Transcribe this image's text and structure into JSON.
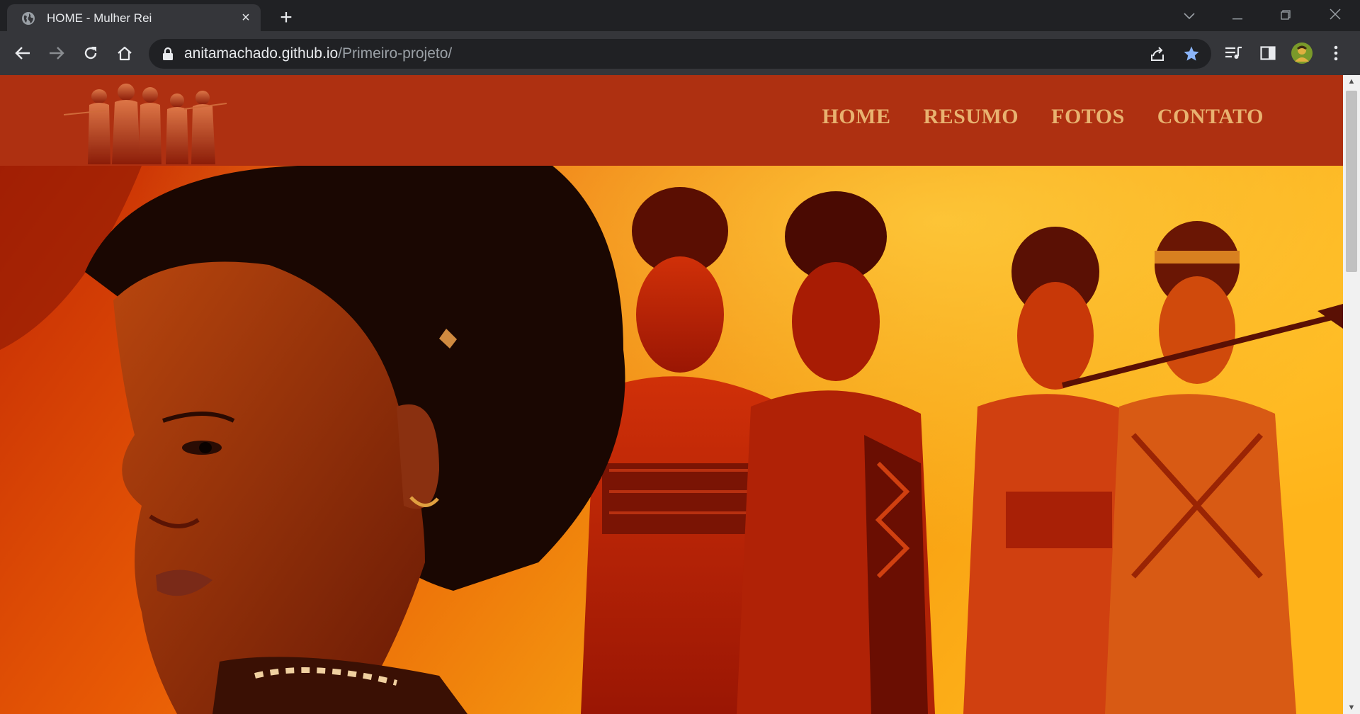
{
  "browser": {
    "tab": {
      "title": "HOME - Mulher Rei",
      "favicon": "globe-icon"
    },
    "new_tab_symbol": "+",
    "url": {
      "host": "anitamachado.github.io",
      "path": "/Primeiro-projeto/"
    },
    "bookmarked": true,
    "colors": {
      "tabstrip": "#202124",
      "toolbar": "#35363a",
      "omnibox": "#202124",
      "star": "#8ab4f8"
    }
  },
  "site": {
    "logo_alt": "Mulher Rei logo",
    "nav": [
      {
        "label": "HOME"
      },
      {
        "label": "RESUMO"
      },
      {
        "label": "FOTOS"
      },
      {
        "label": "CONTATO"
      }
    ],
    "colors": {
      "header": "#ae3011",
      "nav_text": "#e8b270",
      "hero_orange": "#f07a00",
      "hero_red": "#d62a00"
    },
    "hero_alt": "The Woman King poster artwork"
  }
}
